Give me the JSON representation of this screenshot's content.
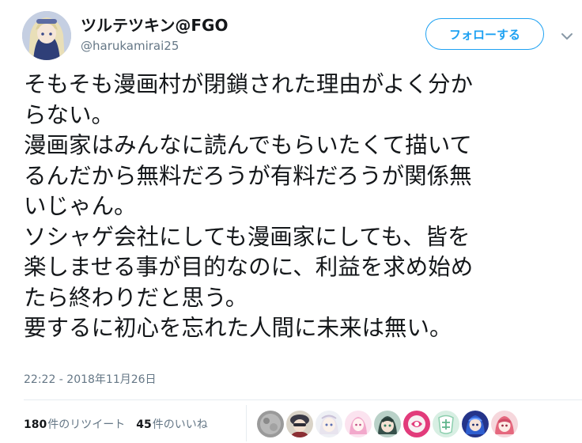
{
  "user": {
    "display_name": "ツルテツキン@FGO",
    "screen_name": "@harukamirai25",
    "avatar_icon": "user-avatar-icon"
  },
  "actions": {
    "follow_label": "フォローする",
    "menu_icon": "chevron-down-icon"
  },
  "tweet": {
    "lines": [
      "そもそも漫画村が閉鎖された理由がよく分か",
      "らない。",
      "漫画家はみんなに読んでもらいたくて描いて",
      "るんだから無料だろうが有料だろうが関係無",
      "いじゃん。",
      "ソシャゲ会社にしても漫画家にしても、皆を",
      "楽しませる事が目的なのに、利益を求め始め",
      "たら終わりだと思う。",
      "要するに初心を忘れた人間に未来は無い。"
    ],
    "timestamp": "22:22 - 2018年11月26日"
  },
  "stats": {
    "retweets_count": "180",
    "retweets_label": "件のリツイート",
    "likes_count": "45",
    "likes_label": "件のいいね"
  },
  "likers": [
    "liker-avatar-1-icon",
    "liker-avatar-2-icon",
    "liker-avatar-3-icon",
    "liker-avatar-4-icon",
    "liker-avatar-5-icon",
    "liker-avatar-6-icon",
    "liker-avatar-7-icon",
    "liker-avatar-8-icon",
    "liker-avatar-9-icon"
  ],
  "colors": {
    "accent": "#1da1f2",
    "text": "#14171a",
    "muted": "#657786",
    "divider": "#e6ecf0"
  }
}
